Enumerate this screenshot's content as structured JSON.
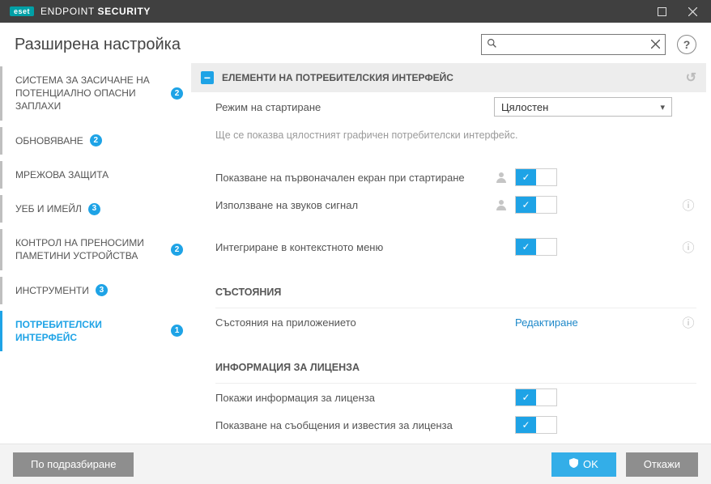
{
  "title": {
    "brand": "eset",
    "product_light": "ENDPOINT",
    "product_bold": "SECURITY"
  },
  "page_heading": "Разширена настройка",
  "search": {
    "placeholder": ""
  },
  "sidebar": {
    "items": [
      {
        "label": "СИСТЕМА ЗА ЗАСИЧАНЕ НА ПОТЕНЦИАЛНО ОПАСНИ ЗАПЛАХИ",
        "badge": "2"
      },
      {
        "label": "ОБНОВЯВАНЕ",
        "badge": "2"
      },
      {
        "label": "МРЕЖОВА ЗАЩИТА",
        "badge": ""
      },
      {
        "label": "УЕБ И ИМЕЙЛ",
        "badge": "3"
      },
      {
        "label": "КОНТРОЛ НА ПРЕНОСИМИ ПАМЕТИНИ УСТРОЙСТВА",
        "badge": "2"
      },
      {
        "label": "ИНСТРУМЕНТИ",
        "badge": "3"
      },
      {
        "label": "ПОТРЕБИТЕЛСКИ ИНТЕРФЕЙС",
        "badge": "1"
      }
    ]
  },
  "section": {
    "title": "ЕЛЕМЕНТИ НА ПОТРЕБИТЕЛСКИЯ ИНТЕРФЕЙС",
    "startup_mode_label": "Режим на стартиране",
    "startup_mode_value": "Цялостен",
    "startup_mode_desc": "Ще се показва цялостният графичен потребителски интерфейс.",
    "splash_label": "Показване на първоначален екран при стартиране",
    "sound_label": "Използване на звуков сигнал",
    "context_label": "Интегриране в контекстното меню"
  },
  "statuses": {
    "header": "СЪСТОЯНИЯ",
    "app_label": "Състояния на приложението",
    "edit_link": "Редактиране"
  },
  "license": {
    "header": "ИНФОРМАЦИЯ ЗА ЛИЦЕНЗА",
    "show_label": "Покажи информация за лиценза",
    "notify_label": "Показване на съобщения и известия за лиценза"
  },
  "buttons": {
    "defaults": "По подразбиране",
    "ok": "OK",
    "cancel": "Откажи"
  }
}
